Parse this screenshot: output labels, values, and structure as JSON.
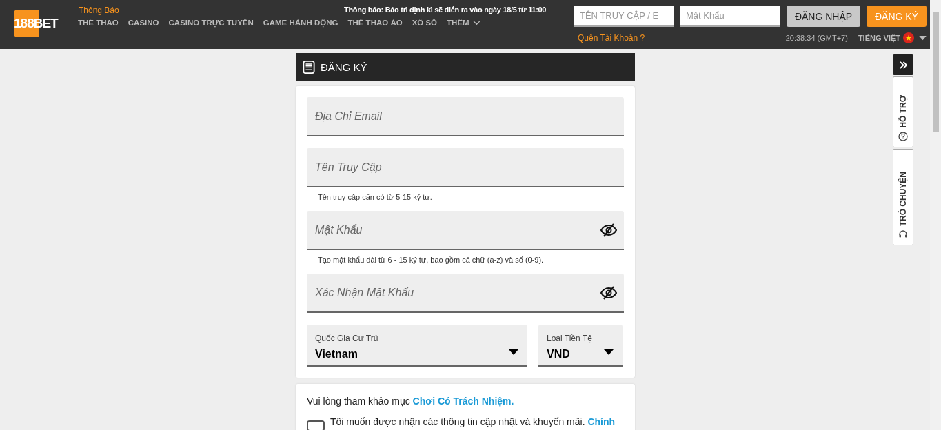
{
  "header": {
    "logo": "188BET",
    "notice_label": "Thông Báo",
    "notice": "Thông báo: Bảo trì định kì sẽ diễn ra vào ngày 18/5 từ 11:00",
    "nav": [
      {
        "label": "THỂ THAO",
        "dropdown": false
      },
      {
        "label": "CASINO",
        "dropdown": false
      },
      {
        "label": "CASINO TRỰC TUYẾN",
        "dropdown": false
      },
      {
        "label": "GAME HÀNH ĐỘNG",
        "dropdown": false
      },
      {
        "label": "THỂ THAO ẢO",
        "dropdown": false
      },
      {
        "label": "XỔ SỐ",
        "dropdown": false
      },
      {
        "label": "THÊM",
        "dropdown": true
      }
    ],
    "username": {
      "placeholder": "TÊN TRUY CẬP / E"
    },
    "password": {
      "placeholder": "Mật Khẩu"
    },
    "login_button": "ĐĂNG NHẬP",
    "register_button": "ĐĂNG KÝ",
    "forgot": "Quên Tài Khoản ?",
    "time": "20:38:34 (GMT+7)",
    "language": "TIẾNG VIỆT"
  },
  "form": {
    "title": "ĐĂNG KÝ",
    "fields": [
      {
        "kind": "text",
        "placeholder": "Địa Chỉ Email"
      },
      {
        "kind": "text",
        "placeholder": "Tên Truy Cập",
        "hint": "Tên truy cập cần có từ 5-15 ký tự."
      },
      {
        "kind": "password",
        "placeholder": "Mật Khẩu",
        "hint": "Tạo mật khẩu dài từ 6 - 15 ký tự, bao gồm cả chữ (a-z) và số (0-9)."
      },
      {
        "kind": "password",
        "placeholder": "Xác Nhận Mật Khẩu"
      }
    ],
    "selects": [
      {
        "label": "Quốc Gia Cư Trú",
        "value": "Vietnam"
      },
      {
        "label": "Loại Tiền Tệ",
        "value": "VND"
      }
    ],
    "responsible_text": "Vui lòng tham khảo mục",
    "responsible_link": "Chơi Có Trách Nhiệm.",
    "newsletter": {
      "text": "Tôi muốn được nhận các thông tin cập nhật và khuyến mãi.",
      "link": "Chính",
      "checked": false
    }
  },
  "side_tabs": [
    {
      "label": "HỖ TRỢ"
    },
    {
      "label": "TRÒ CHUYỆN"
    }
  ]
}
